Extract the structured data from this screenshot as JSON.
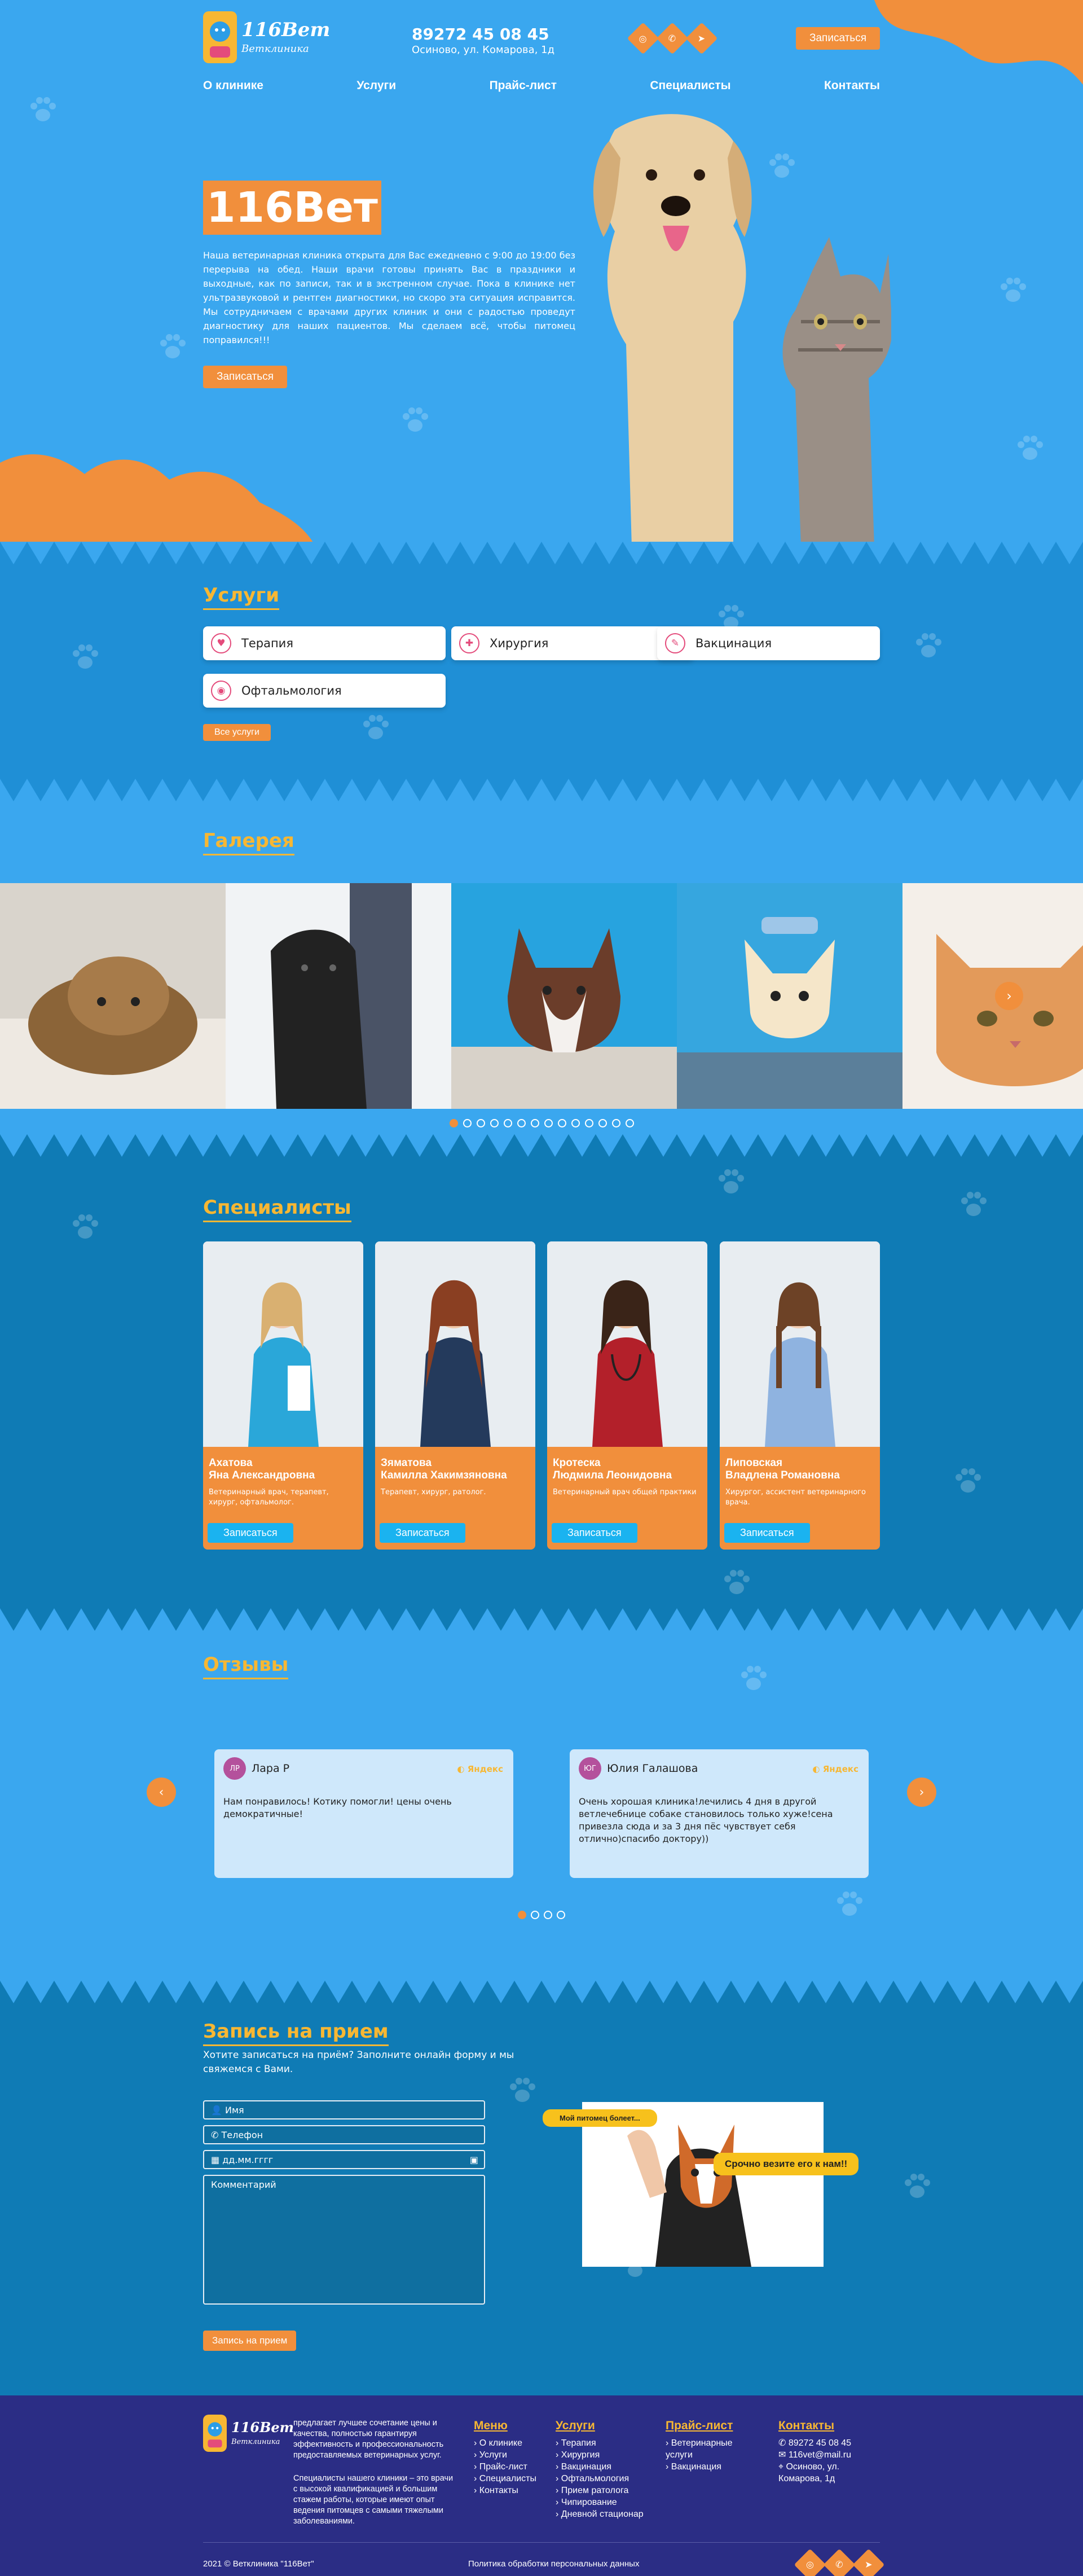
{
  "header": {
    "logo_name": "116Вет",
    "logo_sub": "Ветклиника",
    "phone": "89272 45 08 45",
    "address": "Осиново, ул. Комарова, 1д",
    "social": [
      "instagram-icon",
      "whatsapp-icon",
      "telegram-icon"
    ],
    "cta": "Записаться",
    "nav": [
      "О клинике",
      "Услуги",
      "Прайс-лист",
      "Специалисты",
      "Контакты"
    ]
  },
  "hero": {
    "title": "116Вет",
    "text": "Наша ветеринарная клиника открыта для Вас ежедневно с 9:00 до 19:00 без перерыва на обед. Наши врачи готовы принять Вас в праздники и выходные, как по записи, так и в экстренном случае. Пока в клинике нет ультразвуковой и рентген диагностики, но скоро эта ситуация исправится. Мы сотрудничаем с врачами других клиник и они с радостью проведут диагностику для наших пациентов. Мы сделаем всё, чтобы питомец поправился!!!",
    "cta": "Записаться"
  },
  "services": {
    "title": "Услуги",
    "items": [
      {
        "label": "Терапия",
        "icon": "stethoscope-icon"
      },
      {
        "label": "Хирургия",
        "icon": "surgery-icon"
      },
      {
        "label": "Вакцинация",
        "icon": "syringe-icon"
      },
      {
        "label": "Офтальмология",
        "icon": "eye-icon"
      }
    ],
    "all": "Все услуги"
  },
  "gallery": {
    "title": "Галерея",
    "photos": [
      "yorkshire-terrier-photo",
      "cane-corso-photo",
      "husky-puppy-photo",
      "chihuahua-photo",
      "ginger-cat-photo"
    ],
    "dots_total": 14,
    "dots_active": 0
  },
  "specialists": {
    "title": "Специалисты",
    "cta": "Записаться",
    "items": [
      {
        "name1": "Ахатова",
        "name2": "Яна Александровна",
        "role": "Ветеринарный врач, терапевт, хирург, офтальмолог."
      },
      {
        "name1": "Зяматова",
        "name2": "Камилла Хакимзяновна",
        "role": "Терапевт, хирург, ратолог."
      },
      {
        "name1": "Кротеска",
        "name2": "Людмила Леонидовна",
        "role": "Ветеринарный врач общей практики"
      },
      {
        "name1": "Липовская",
        "name2": "Владлена Романовна",
        "role": "Хирургог, ассистент ветеринарного врача."
      }
    ]
  },
  "reviews": {
    "title": "Отзывы",
    "source": "Яндекс",
    "items": [
      {
        "initials": "ЛР",
        "name": "Лара Р",
        "text": "Нам понравилось! Котику помогли! цены очень демократичные!"
      },
      {
        "initials": "ЮГ",
        "name": "Юлия Галашова",
        "text": "Очень хорошая клиника!лечились 4 дня в другой ветлечебнице собаке становилось только хуже!сена привезла сюда и за 3 дня пёс чувствует себя отлично)спасибо доктору))"
      }
    ],
    "dots_total": 4,
    "dots_active": 0
  },
  "booking": {
    "title": "Запись на прием",
    "subtitle": "Хотите записаться на приём? Заполните онлайн форму и мы свяжемся с Вами.",
    "name_ph": "Имя",
    "phone_ph": "Телефон",
    "date_ph": "дд.мм.гггг",
    "comment_ph": "Комментарий",
    "submit": "Запись на прием",
    "bubble1": "Мой питомец болеет...",
    "bubble2": "Срочно везите его к нам!!"
  },
  "footer": {
    "logo_name": "116Вет",
    "logo_sub": "Ветклиника",
    "desc1": "предлагает лучшее сочетание цены и качества, полностью гарантируя эффективность и профессиональность предоставляемых ветеринарных услуг.",
    "desc2": "Специалисты нашего клиники – это врачи с высокой квалификацией и большим стажем работы, которые имеют опыт ведения питомцев с самыми тяжелыми заболеваниями.",
    "menu_title": "Меню",
    "menu": [
      "О клинике",
      "Услуги",
      "Прайс-лист",
      "Специалисты",
      "Контакты"
    ],
    "svc_title": "Услуги",
    "svc": [
      "Терапия",
      "Хирургия",
      "Вакцинация",
      "Офтальмология",
      "Прием ратолога",
      "Чипирование",
      "Дневной стационар"
    ],
    "price_title": "Прайс-лист",
    "price": [
      "Ветеринарные услуги",
      "Вакцинация"
    ],
    "contacts_title": "Контакты",
    "phone": "89272 45 08 45",
    "email": "116vet@mail.ru",
    "address": "Осиново, ул. Комарова, 1д",
    "copyright": "2021 © Ветклиника \"116Вет\"",
    "policy": "Политика обработки персональных данных"
  },
  "colors": {
    "orange": "#f18f3c",
    "yellow": "#f7b733",
    "blue": "#3aa7ef",
    "dark_blue": "#0f7bb5",
    "footer": "#2b2d85"
  }
}
